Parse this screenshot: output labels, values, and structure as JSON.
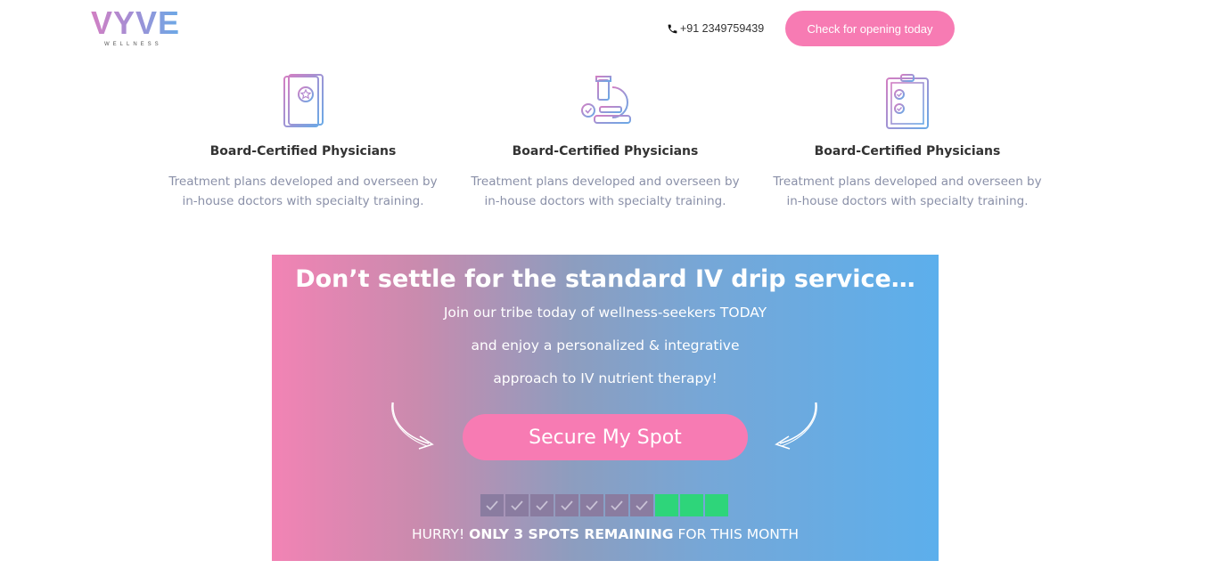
{
  "header": {
    "logo_text": "VYVE",
    "logo_sub": "WELLNESS",
    "phone": "+91 2349759439",
    "cta_label": "Check for opening today"
  },
  "features": [
    {
      "icon": "certificate-icon",
      "title": "Board-Certified Physicians",
      "desc": "Treatment plans developed and overseen by in-house doctors with specialty training."
    },
    {
      "icon": "microscope-icon",
      "title": "Board-Certified Physicians",
      "desc": "Treatment plans developed and overseen by in-house doctors with specialty training."
    },
    {
      "icon": "clipboard-icon",
      "title": "Board-Certified Physicians",
      "desc": "Treatment plans developed and overseen by in-house doctors with specialty training."
    }
  ],
  "banner": {
    "headline": "Don’t settle for the standard IV drip service…",
    "line1": "Join our tribe today of wellness-seekers TODAY",
    "line2": "and enjoy a personalized & integrative",
    "line3": "approach to IV nutrient therapy!",
    "button_label": "Secure My Spot",
    "spots_taken": 7,
    "spots_open": 3,
    "hurry_prefix": "HURRY! ",
    "hurry_bold": "ONLY 3 SPOTS REMAINING",
    "hurry_suffix": " FOR THIS MONTH"
  },
  "colors": {
    "brand_pink": "#f77bb3",
    "spot_taken": "#8a7ca0",
    "spot_open": "#2ed57a"
  }
}
